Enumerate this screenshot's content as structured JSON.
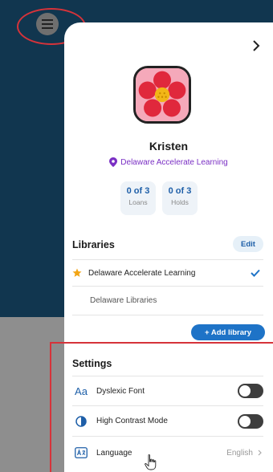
{
  "profile": {
    "name": "Kristen",
    "home_library": "Delaware Accelerate Learning"
  },
  "stats": [
    {
      "value": "0 of 3",
      "label": "Loans"
    },
    {
      "value": "0 of 3",
      "label": "Holds"
    }
  ],
  "libraries": {
    "title": "Libraries",
    "edit_label": "Edit",
    "items": [
      {
        "name": "Delaware Accelerate Learning",
        "favorite": true,
        "selected": true
      },
      {
        "name": "Delaware Libraries",
        "favorite": false,
        "selected": false
      }
    ],
    "add_label": "+ Add library"
  },
  "settings": {
    "title": "Settings",
    "dyslexic_icon_text": "Aa",
    "items": [
      {
        "label": "Dyslexic Font",
        "icon": "font-icon",
        "toggle": false
      },
      {
        "label": "High Contrast Mode",
        "icon": "contrast-icon",
        "toggle": false
      },
      {
        "label": "Language",
        "icon": "language-icon",
        "value": "English"
      }
    ]
  },
  "colors": {
    "accent": "#1e73c7",
    "library_name": "#7a2fc4",
    "annotation": "#d6333a",
    "background_app": "#11364f"
  }
}
